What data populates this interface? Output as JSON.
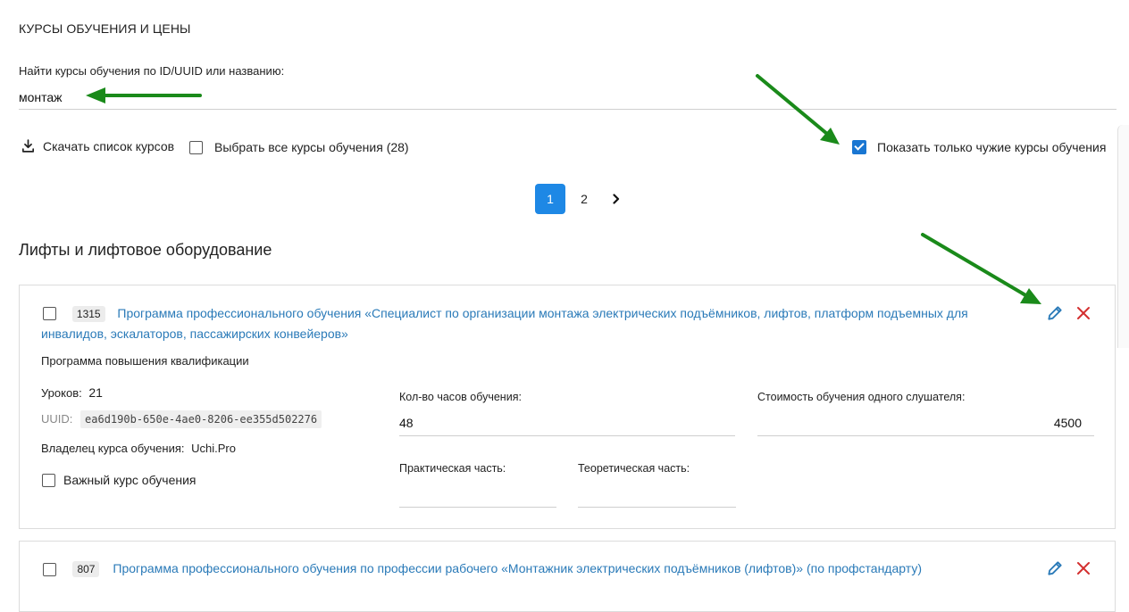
{
  "page": {
    "title": "КУРСЫ ОБУЧЕНИЯ И ЦЕНЫ"
  },
  "search": {
    "label": "Найти курсы обучения по ID/UUID или названию:",
    "value": "монтаж"
  },
  "toolbar": {
    "download_label": "Скачать список курсов",
    "download_icon": "download-icon",
    "select_all_label": "Выбрать все курсы обучения (28)",
    "select_all_checked": false,
    "show_foreign_label": "Показать только чужие курсы обучения",
    "show_foreign_checked": true
  },
  "pagination": {
    "pages": [
      "1",
      "2"
    ],
    "active": "1",
    "next_icon": "chevron-right-icon"
  },
  "section": {
    "title": "Лифты и лифтовое оборудование"
  },
  "courses": [
    {
      "id": "1315",
      "title": "Программа профессионального обучения «Специалист по организации монтажа электрических подъёмников, лифтов, платформ подъемных для инвалидов, эскалаторов, пассажирских конвейеров»",
      "type": "Программа повышения квалификации",
      "lessons_label": "Уроков:",
      "lessons_value": "21",
      "uuid_label": "UUID:",
      "uuid_value": "ea6d190b-650e-4ae0-8206-ee355d502276",
      "owner_label": "Владелец курса обучения:",
      "owner_value": "Uchi.Pro",
      "important_label": "Важный курс обучения",
      "hours_label": "Кол-во часов обучения:",
      "hours_value": "48",
      "price_label": "Стоимость обучения одного слушателя:",
      "price_value": "4500",
      "practice_label": "Практическая часть:",
      "practice_value": "",
      "theory_label": "Теоретическая часть:",
      "theory_value": ""
    },
    {
      "id": "807",
      "title": "Программа профессионального обучения по профессии рабочего «Монтажник электрических подъёмников (лифтов)» (по профстандарту)"
    }
  ],
  "colors": {
    "link": "#2a7ab8",
    "accent": "#1e88e5",
    "delete": "#d32f2f",
    "annotation_arrow": "#1a8a1a"
  }
}
